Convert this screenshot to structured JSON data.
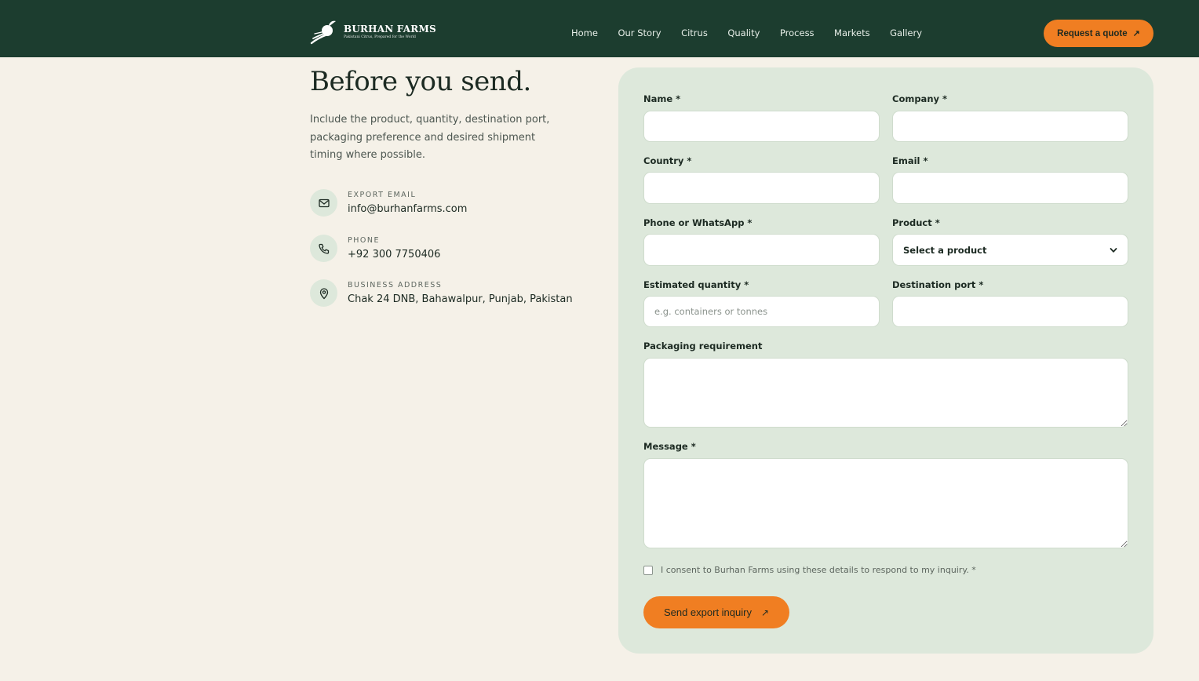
{
  "header": {
    "brand_name": "BURHAN FARMS",
    "brand_tagline": "Pakistani Citrus, Prepared for the World",
    "nav": [
      "Home",
      "Our Story",
      "Citrus",
      "Quality",
      "Process",
      "Markets",
      "Gallery"
    ],
    "cta_label": "Request a quote",
    "cta_arrow": "↗"
  },
  "intro": {
    "title": "Before you send.",
    "body": "Include the product, quantity, destination port, packaging preference and desired shipment timing where possible."
  },
  "contacts": [
    {
      "label": "EXPORT EMAIL",
      "value": "info@burhanfarms.com",
      "icon": "mail-icon"
    },
    {
      "label": "PHONE",
      "value": "+92 300 7750406",
      "icon": "phone-icon"
    },
    {
      "label": "BUSINESS ADDRESS",
      "value": "Chak 24 DNB, Bahawalpur, Punjab, Pakistan",
      "icon": "location-pin-icon"
    }
  ],
  "form": {
    "name_label": "Name *",
    "company_label": "Company *",
    "country_label": "Country *",
    "email_label": "Email *",
    "phone_label": "Phone or WhatsApp *",
    "product_label": "Product *",
    "product_selected": "Select a product",
    "quantity_label": "Estimated quantity *",
    "quantity_placeholder": "e.g. containers or tonnes",
    "port_label": "Destination port *",
    "packaging_label": "Packaging requirement",
    "message_label": "Message *",
    "consent_text": "I consent to Burhan Farms using these details to respond to my inquiry. *",
    "submit_label": "Send export inquiry",
    "submit_arrow": "↗"
  },
  "colors": {
    "header_bg": "#1c3d2f",
    "accent": "#f07e22",
    "card_bg": "#dde8db",
    "page_bg": "#f5f1e8"
  }
}
